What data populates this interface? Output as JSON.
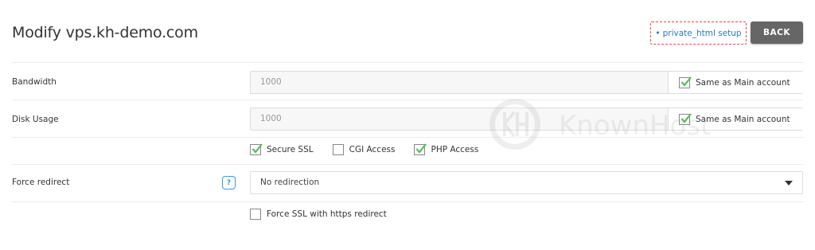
{
  "header": {
    "title": "Modify vps.kh-demo.com",
    "setup_link": "private_html setup",
    "setup_bullet": "•",
    "back_label": "BACK"
  },
  "bandwidth": {
    "label": "Bandwidth",
    "value": "1000",
    "same_as_main": "Same as Main account",
    "same_checked": true
  },
  "disk_usage": {
    "label": "Disk Usage",
    "value": "1000",
    "same_as_main": "Same as Main account",
    "same_checked": true
  },
  "options": [
    {
      "label": "Secure SSL",
      "checked": true
    },
    {
      "label": "CGI Access",
      "checked": false
    },
    {
      "label": "PHP Access",
      "checked": true
    }
  ],
  "force_redirect": {
    "label": "Force redirect",
    "help": "?",
    "selected": "No redirection"
  },
  "force_ssl": {
    "label": "Force SSL with https redirect",
    "checked": false
  },
  "watermark": {
    "text": "KnownHost",
    "icon": "kh-logo-icon"
  },
  "colors": {
    "check": "#5cb85c",
    "link": "#2a7ab8",
    "dashed_border": "#e04848",
    "back_button": "#666666"
  }
}
